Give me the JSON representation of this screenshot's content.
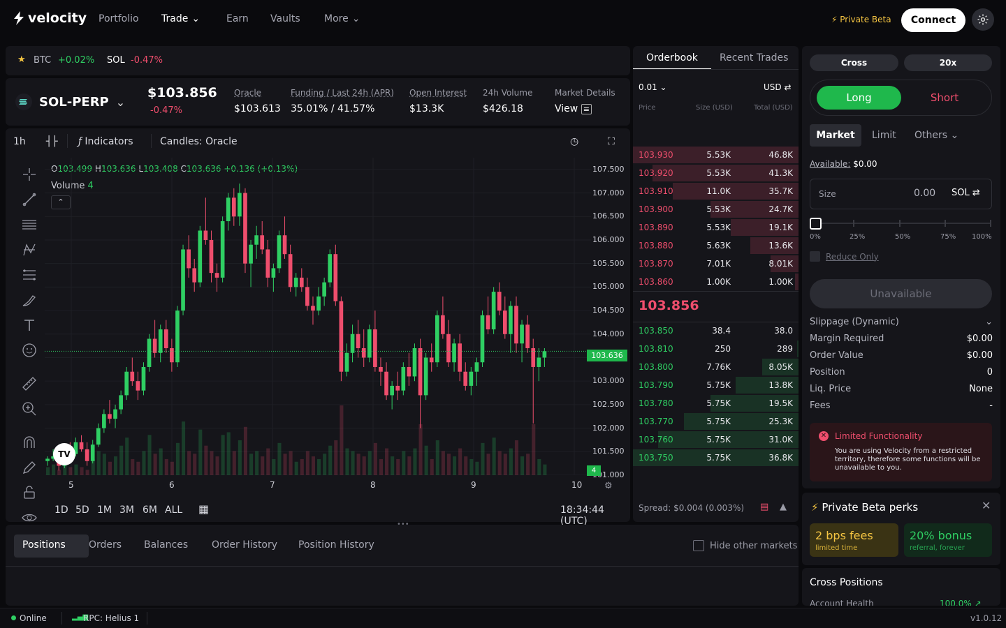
{
  "nav": {
    "brand": "velocity",
    "items": [
      {
        "label": "Portfolio",
        "active": false,
        "dropdown": false
      },
      {
        "label": "Trade",
        "active": true,
        "dropdown": true
      },
      {
        "label": "Earn",
        "active": false,
        "dropdown": false
      },
      {
        "label": "Vaults",
        "active": false,
        "dropdown": false
      },
      {
        "label": "More",
        "active": false,
        "dropdown": true
      }
    ],
    "beta_label": "Private Beta",
    "connect_label": "Connect"
  },
  "watchlist": [
    {
      "symbol": "BTC",
      "change": "+0.02%",
      "dir": "up"
    },
    {
      "symbol": "SOL",
      "change": "-0.47%",
      "dir": "down"
    }
  ],
  "market": {
    "symbol": "SOL-PERP",
    "price": "$103.856",
    "change": "-0.47%",
    "stats": [
      {
        "label": "Oracle",
        "value": "$103.613"
      },
      {
        "label": "Funding / Last 24h (APR)",
        "value": "35.01% / 41.57%"
      },
      {
        "label": "Open Interest",
        "value": "$13.3K"
      },
      {
        "label": "24h Volume",
        "value": "$426.18"
      },
      {
        "label": "Market Details",
        "value": "View"
      }
    ]
  },
  "chart_toolbar": {
    "interval": "1h",
    "indicators": "Indicators",
    "candles": "Candles: Oracle"
  },
  "chart_legend": {
    "o_label": "O",
    "o": "103.499",
    "h_label": "H",
    "h": "103.636",
    "l_label": "L",
    "l": "103.408",
    "c_label": "C",
    "c": "103.636",
    "chg": "+0.136 (+0.13%)",
    "volume_label": "Volume",
    "volume": "4"
  },
  "chart_data": {
    "type": "candlestick",
    "y_ticks": [
      "107.500",
      "107.000",
      "106.500",
      "106.000",
      "105.500",
      "105.000",
      "104.500",
      "104.000",
      "103.500",
      "103.000",
      "102.500",
      "102.000",
      "101.500",
      "101.000"
    ],
    "x_ticks": [
      "5",
      "6",
      "7",
      "8",
      "9",
      "10"
    ],
    "ylim": [
      101.0,
      107.75
    ],
    "last_price": "103.636",
    "volume_badge": "4",
    "candles": [
      [
        101.3,
        101.4,
        101.2,
        101.35
      ],
      [
        101.35,
        101.55,
        101.3,
        101.4
      ],
      [
        101.4,
        101.5,
        101.1,
        101.2
      ],
      [
        101.2,
        101.6,
        101.15,
        101.55
      ],
      [
        101.55,
        101.7,
        101.4,
        101.45
      ],
      [
        101.45,
        101.8,
        101.4,
        101.7
      ],
      [
        101.7,
        101.85,
        101.5,
        101.55
      ],
      [
        101.55,
        101.7,
        101.2,
        101.3
      ],
      [
        101.3,
        101.75,
        101.25,
        101.65
      ],
      [
        101.65,
        102.1,
        101.6,
        102.0
      ],
      [
        102.0,
        102.4,
        101.9,
        102.3
      ],
      [
        102.3,
        102.6,
        102.1,
        102.2
      ],
      [
        102.2,
        102.5,
        102.0,
        102.4
      ],
      [
        102.4,
        102.8,
        102.3,
        102.7
      ],
      [
        102.7,
        103.3,
        102.6,
        103.2
      ],
      [
        103.2,
        103.5,
        102.9,
        103.0
      ],
      [
        103.0,
        103.2,
        102.6,
        102.8
      ],
      [
        102.8,
        103.4,
        102.7,
        103.3
      ],
      [
        103.3,
        104.0,
        103.2,
        103.9
      ],
      [
        103.9,
        104.3,
        103.5,
        103.6
      ],
      [
        103.6,
        104.2,
        103.4,
        104.1
      ],
      [
        104.1,
        104.3,
        103.6,
        103.7
      ],
      [
        103.7,
        103.9,
        103.2,
        103.4
      ],
      [
        103.4,
        104.6,
        103.3,
        104.5
      ],
      [
        104.5,
        105.9,
        104.4,
        105.8
      ],
      [
        105.8,
        106.1,
        105.2,
        105.4
      ],
      [
        105.4,
        105.6,
        104.9,
        105.1
      ],
      [
        105.1,
        106.3,
        105.0,
        106.2
      ],
      [
        106.2,
        106.9,
        105.9,
        106.0
      ],
      [
        106.0,
        106.2,
        105.1,
        105.3
      ],
      [
        105.3,
        105.5,
        104.9,
        105.2
      ],
      [
        105.2,
        106.5,
        105.1,
        106.4
      ],
      [
        106.4,
        107.0,
        106.2,
        106.9
      ],
      [
        106.9,
        107.1,
        106.3,
        106.5
      ],
      [
        106.5,
        107.2,
        106.3,
        107.0
      ],
      [
        107.0,
        107.1,
        105.3,
        105.5
      ],
      [
        105.5,
        106.0,
        105.0,
        105.9
      ],
      [
        105.9,
        106.3,
        105.6,
        106.1
      ],
      [
        106.1,
        106.4,
        105.7,
        105.8
      ],
      [
        105.8,
        106.0,
        105.0,
        105.2
      ],
      [
        105.2,
        105.5,
        104.9,
        105.4
      ],
      [
        105.4,
        106.2,
        105.3,
        106.1
      ],
      [
        106.1,
        106.5,
        105.6,
        105.7
      ],
      [
        105.7,
        105.9,
        104.9,
        105.0
      ],
      [
        105.0,
        105.3,
        104.8,
        105.2
      ],
      [
        105.2,
        105.4,
        104.9,
        105.0
      ],
      [
        105.0,
        105.2,
        104.5,
        104.6
      ],
      [
        104.6,
        104.8,
        104.2,
        104.5
      ],
      [
        104.5,
        105.0,
        104.4,
        104.8
      ],
      [
        104.8,
        105.2,
        104.6,
        105.1
      ],
      [
        105.1,
        105.8,
        105.0,
        105.7
      ],
      [
        105.7,
        105.9,
        104.6,
        104.7
      ],
      [
        104.7,
        104.8,
        103.0,
        103.2
      ],
      [
        103.2,
        103.8,
        103.1,
        103.6
      ],
      [
        103.6,
        104.2,
        103.4,
        104.0
      ],
      [
        104.0,
        104.3,
        103.5,
        103.7
      ],
      [
        103.7,
        104.1,
        103.3,
        103.5
      ],
      [
        103.5,
        104.2,
        103.4,
        104.1
      ],
      [
        104.1,
        104.5,
        103.2,
        103.3
      ],
      [
        103.3,
        103.5,
        102.9,
        103.2
      ],
      [
        103.2,
        103.4,
        102.6,
        102.7
      ],
      [
        102.7,
        103.0,
        102.4,
        102.9
      ],
      [
        102.9,
        103.2,
        102.6,
        102.8
      ],
      [
        102.8,
        103.4,
        102.7,
        103.3
      ],
      [
        103.3,
        103.6,
        102.9,
        103.1
      ],
      [
        103.1,
        103.8,
        103.0,
        103.7
      ],
      [
        103.7,
        103.9,
        102.0,
        102.7
      ],
      [
        102.7,
        103.6,
        102.6,
        103.5
      ],
      [
        103.5,
        103.8,
        103.2,
        103.4
      ],
      [
        103.4,
        104.5,
        103.3,
        104.4
      ],
      [
        104.4,
        104.8,
        103.9,
        104.0
      ],
      [
        104.0,
        104.3,
        103.3,
        103.4
      ],
      [
        103.4,
        103.9,
        103.2,
        103.8
      ],
      [
        103.8,
        104.0,
        103.0,
        103.2
      ],
      [
        103.2,
        103.4,
        102.8,
        102.9
      ],
      [
        102.9,
        103.3,
        102.7,
        103.2
      ],
      [
        103.2,
        103.5,
        102.9,
        103.4
      ],
      [
        103.4,
        104.5,
        103.3,
        104.4
      ],
      [
        104.4,
        104.8,
        104.0,
        104.1
      ],
      [
        104.1,
        105.0,
        104.0,
        104.9
      ],
      [
        104.9,
        105.1,
        104.4,
        104.5
      ],
      [
        104.5,
        104.8,
        103.9,
        104.0
      ],
      [
        104.0,
        104.7,
        103.6,
        104.6
      ],
      [
        104.6,
        104.8,
        103.6,
        103.8
      ],
      [
        103.8,
        104.3,
        103.4,
        104.2
      ],
      [
        104.2,
        104.4,
        103.6,
        103.7
      ],
      [
        103.7,
        103.9,
        102.1,
        103.3
      ],
      [
        103.3,
        103.7,
        103.0,
        103.5
      ],
      [
        103.5,
        103.7,
        103.3,
        103.636
      ]
    ],
    "volumes": [
      0.3,
      0.4,
      0.2,
      0.5,
      0.3,
      0.4,
      0.3,
      0.2,
      0.6,
      0.9,
      0.8,
      0.5,
      0.7,
      1.1,
      1.4,
      0.6,
      0.5,
      0.9,
      1.5,
      0.8,
      1.0,
      0.6,
      0.5,
      1.2,
      2.0,
      0.9,
      0.8,
      1.7,
      1.1,
      0.9,
      0.7,
      1.5,
      1.6,
      0.9,
      1.3,
      1.8,
      0.8,
      0.9,
      0.7,
      1.0,
      0.6,
      1.2,
      0.8,
      0.9,
      0.5,
      0.6,
      0.9,
      0.7,
      0.6,
      0.8,
      1.1,
      1.3,
      2.6,
      1.0,
      0.9,
      0.8,
      0.7,
      0.9,
      1.2,
      0.6,
      1.0,
      0.7,
      0.6,
      0.9,
      0.7,
      1.0,
      1.9,
      1.1,
      0.6,
      1.3,
      0.9,
      0.8,
      0.7,
      1.0,
      0.7,
      0.6,
      0.5,
      1.2,
      0.8,
      1.4,
      0.9,
      0.8,
      1.0,
      1.3,
      0.7,
      0.8,
      1.9,
      0.6,
      0.4
    ]
  },
  "chart_bottom": {
    "ranges": [
      "1D",
      "5D",
      "1M",
      "3M",
      "6M",
      "ALL"
    ],
    "time": "18:34:44 (UTC)"
  },
  "orderbook": {
    "tabs": [
      "Orderbook",
      "Recent Trades"
    ],
    "tick": "0.01",
    "unit": "USD",
    "col_price": "Price",
    "col_size": "Size (USD)",
    "col_total": "Total (USD)",
    "asks": [
      {
        "price": "103.930",
        "size": "5.53K",
        "total": "46.8K",
        "depth": 1.0
      },
      {
        "price": "103.920",
        "size": "5.53K",
        "total": "41.3K",
        "depth": 0.88
      },
      {
        "price": "103.910",
        "size": "11.0K",
        "total": "35.7K",
        "depth": 0.76
      },
      {
        "price": "103.900",
        "size": "5.53K",
        "total": "24.7K",
        "depth": 0.53
      },
      {
        "price": "103.890",
        "size": "5.53K",
        "total": "19.1K",
        "depth": 0.41
      },
      {
        "price": "103.880",
        "size": "5.63K",
        "total": "13.6K",
        "depth": 0.29
      },
      {
        "price": "103.870",
        "size": "7.01K",
        "total": "8.01K",
        "depth": 0.17
      },
      {
        "price": "103.860",
        "size": "1.00K",
        "total": "1.00K",
        "depth": 0.02
      }
    ],
    "mid": "103.856",
    "bids": [
      {
        "price": "103.850",
        "size": "38.4",
        "total": "38.0",
        "depth": 0.0
      },
      {
        "price": "103.810",
        "size": "250",
        "total": "289",
        "depth": 0.01
      },
      {
        "price": "103.800",
        "size": "7.76K",
        "total": "8.05K",
        "depth": 0.22
      },
      {
        "price": "103.790",
        "size": "5.75K",
        "total": "13.8K",
        "depth": 0.38
      },
      {
        "price": "103.780",
        "size": "5.75K",
        "total": "19.5K",
        "depth": 0.53
      },
      {
        "price": "103.770",
        "size": "5.75K",
        "total": "25.3K",
        "depth": 0.69
      },
      {
        "price": "103.760",
        "size": "5.75K",
        "total": "31.0K",
        "depth": 0.85
      },
      {
        "price": "103.750",
        "size": "5.75K",
        "total": "36.8K",
        "depth": 1.0
      }
    ],
    "spread": "Spread: $0.004 (0.003%)"
  },
  "trade": {
    "margin_mode": "Cross",
    "leverage": "20x",
    "long": "Long",
    "short": "Short",
    "order_types": [
      "Market",
      "Limit",
      "Others"
    ],
    "available_label": "Available:",
    "available_value": "$0.00",
    "size_label": "Size",
    "size_value": "0.00",
    "size_unit": "SOL",
    "slider_marks": [
      "0%",
      "25%",
      "50%",
      "75%",
      "100%"
    ],
    "reduce_only": "Reduce Only",
    "submit": "Unavailable",
    "slippage": "Slippage (Dynamic)",
    "details": [
      {
        "k": "Margin Required",
        "v": "$0.00"
      },
      {
        "k": "Order Value",
        "v": "$0.00"
      },
      {
        "k": "Position",
        "v": "0"
      },
      {
        "k": "Liq. Price",
        "v": "None"
      },
      {
        "k": "Fees",
        "v": "-"
      }
    ],
    "alert_title": "Limited Functionality",
    "alert_body": "You are using Velocity from a restricted territory, therefore some functions will be unavailable to you."
  },
  "perks": {
    "title": "Private Beta perks",
    "card1_title": "2 bps fees",
    "card1_sub": "limited time",
    "card2_title": "20% bonus",
    "card2_sub": "referral, forever"
  },
  "cross": {
    "title": "Cross Positions",
    "health_label": "Account Health",
    "health_value": "100.0%"
  },
  "positions": {
    "tabs": [
      "Positions",
      "Orders",
      "Balances",
      "Order History",
      "Position History"
    ],
    "hide_label": "Hide other markets"
  },
  "status": {
    "online": "Online",
    "rpc": "RPC: Helius 1",
    "version": "v1.0.12"
  },
  "colors": {
    "up": "#2fcf63",
    "down": "#ef4e6d",
    "accent": "#1fb84c",
    "beta": "#f5c542"
  }
}
